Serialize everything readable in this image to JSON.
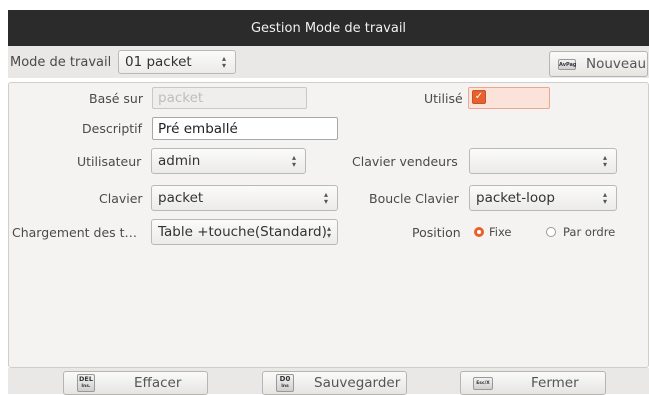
{
  "window": {
    "title": "Gestion Mode de travail"
  },
  "toolbar": {
    "mode_label": "Mode de travail",
    "mode_value": "01 packet",
    "new_button_label": "Nouveau",
    "new_button_key": "AvPag"
  },
  "form": {
    "base_label": "Basé sur",
    "base_placeholder": "packet",
    "used_label": "Utilisé",
    "used_checked": true,
    "description_label": "Descriptif",
    "description_value": "Pré emballé",
    "user_label": "Utilisateur",
    "user_value": "admin",
    "seller_keyboard_label": "Clavier vendeurs",
    "seller_keyboard_value": "",
    "keyboard_label": "Clavier",
    "keyboard_value": "packet",
    "keyboard_loop_label": "Boucle Clavier",
    "keyboard_loop_value": "packet-loop",
    "loading_label": "Chargement des t…",
    "loading_value": "Table +touche(Standard)",
    "position_label": "Position",
    "position_options": [
      "Fixe",
      "Par ordre"
    ],
    "position_selected": "Fixe"
  },
  "buttons": {
    "delete": {
      "label": "Effacer",
      "key_top": "DEL",
      "key_bottom": "Ins."
    },
    "save": {
      "label": "Sauvegarder",
      "key_top": "D0",
      "key_bottom": "Ins"
    },
    "close": {
      "label": "Fermer",
      "key_top": "Esc/X"
    }
  },
  "colors": {
    "accent": "#e8602c",
    "titlebar": "#2b2b2b",
    "panel": "#f4f3f1"
  }
}
